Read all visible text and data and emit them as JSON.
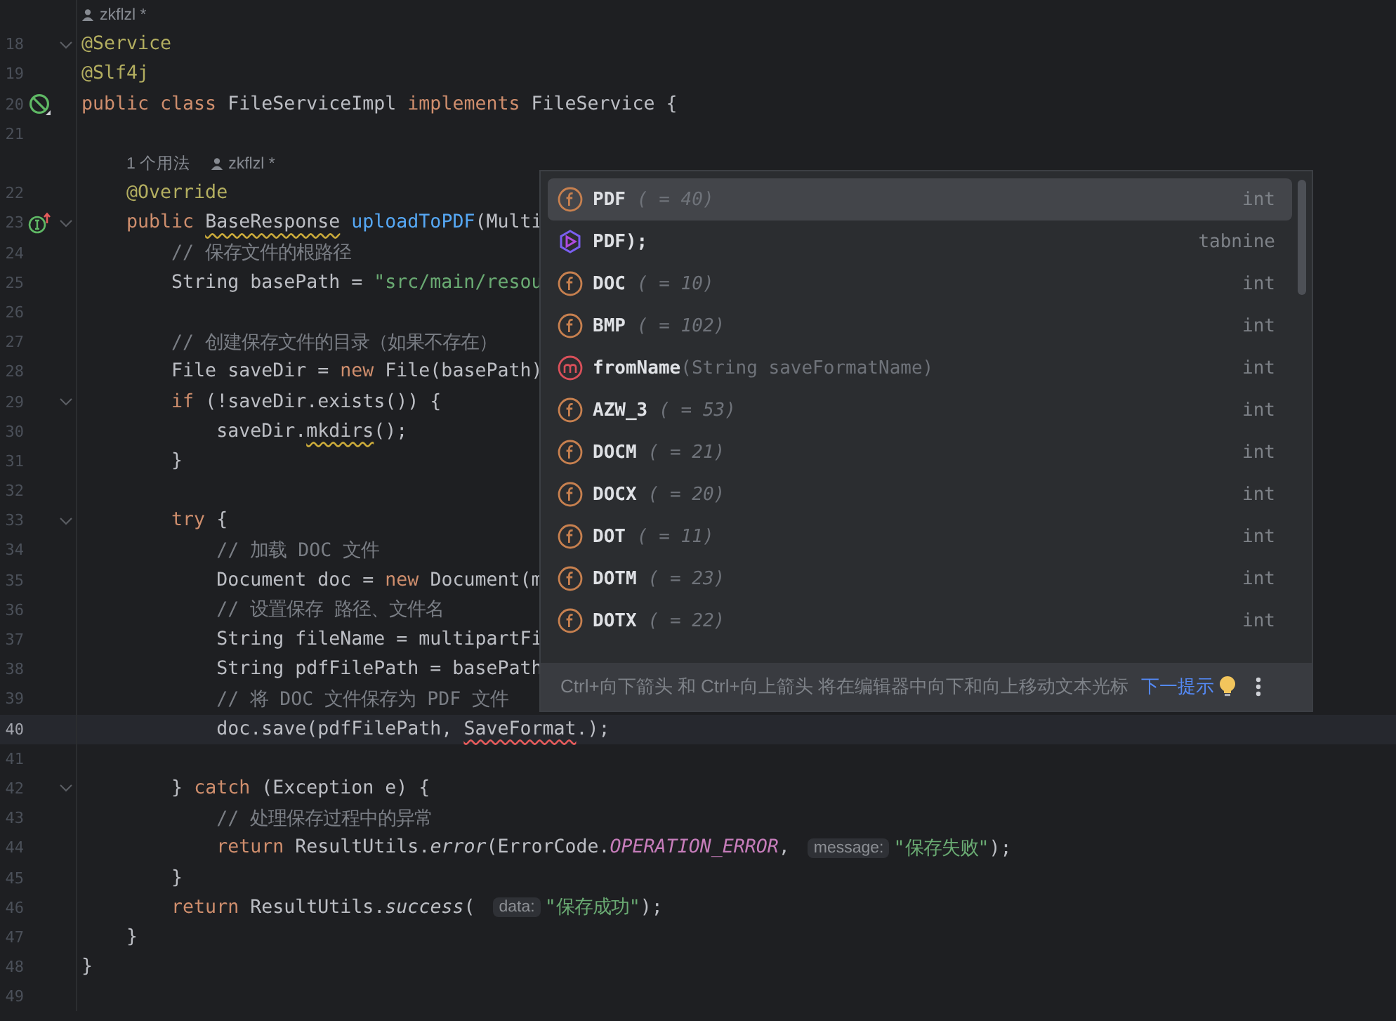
{
  "editor": {
    "lines": [
      {
        "number": "18",
        "fold": true,
        "above": [
          {
            "kind": "author",
            "text": "zkflzl *"
          }
        ],
        "tokens": [
          {
            "kind": "ann",
            "text": "@Service"
          }
        ]
      },
      {
        "number": "19",
        "tokens": [
          {
            "kind": "ann",
            "text": "@Slf4j"
          }
        ]
      },
      {
        "number": "20",
        "gutter_mark": {
          "kind": "bean"
        },
        "tokens": [
          {
            "kind": "kw",
            "text": "public class "
          },
          {
            "kind": "txt",
            "text": "FileServiceImpl "
          },
          {
            "kind": "kw",
            "text": "implements "
          },
          {
            "kind": "txt",
            "text": "FileService {"
          }
        ]
      },
      {
        "number": "21"
      },
      {
        "number": "22",
        "above": [
          {
            "kind": "usage",
            "text": "1 个用法"
          },
          {
            "kind": "author",
            "text": "zkflzl *"
          }
        ],
        "tokens": [
          {
            "kind": "ann",
            "text": "    @Override"
          }
        ]
      },
      {
        "number": "23",
        "fold": true,
        "gutter_mark": {
          "kind": "implements"
        },
        "tokens": [
          {
            "kind": "kw",
            "text": "    public "
          },
          {
            "kind": "txt",
            "text": "BaseResponse",
            "warning": true
          },
          {
            "kind": "fn",
            "text": " uploadToPDF"
          },
          {
            "kind": "txt",
            "text": "(Multi"
          }
        ]
      },
      {
        "number": "24",
        "tokens": [
          {
            "kind": "cmt",
            "text": "        // 保存文件的根路径"
          }
        ]
      },
      {
        "number": "25",
        "tokens": [
          {
            "kind": "txt",
            "text": "        String basePath = "
          },
          {
            "kind": "str",
            "text": "\"src/main/resou"
          }
        ]
      },
      {
        "number": "26"
      },
      {
        "number": "27",
        "tokens": [
          {
            "kind": "cmt",
            "text": "        // 创建保存文件的目录（如果不存在）"
          }
        ]
      },
      {
        "number": "28",
        "tokens": [
          {
            "kind": "txt",
            "text": "        File saveDir = "
          },
          {
            "kind": "kw",
            "text": "new "
          },
          {
            "kind": "txt",
            "text": "File(basePath)"
          }
        ]
      },
      {
        "number": "29",
        "fold": true,
        "tokens": [
          {
            "kind": "kw",
            "text": "        if "
          },
          {
            "kind": "txt",
            "text": "(!saveDir.exists()) {"
          }
        ]
      },
      {
        "number": "30",
        "tokens": [
          {
            "kind": "txt",
            "text": "            saveDir."
          },
          {
            "kind": "txt",
            "text": "mkdirs",
            "warning": true
          },
          {
            "kind": "txt",
            "text": "();"
          }
        ]
      },
      {
        "number": "31",
        "tokens": [
          {
            "kind": "txt",
            "text": "        }"
          }
        ]
      },
      {
        "number": "32"
      },
      {
        "number": "33",
        "fold": true,
        "tokens": [
          {
            "kind": "kw",
            "text": "        try "
          },
          {
            "kind": "txt",
            "text": "{"
          }
        ]
      },
      {
        "number": "34",
        "tokens": [
          {
            "kind": "cmt",
            "text": "            // 加载 DOC 文件"
          }
        ]
      },
      {
        "number": "35",
        "tokens": [
          {
            "kind": "txt",
            "text": "            Document doc = "
          },
          {
            "kind": "kw",
            "text": "new "
          },
          {
            "kind": "txt",
            "text": "Document(m"
          }
        ]
      },
      {
        "number": "36",
        "tokens": [
          {
            "kind": "cmt",
            "text": "            // 设置保存 路径、文件名"
          }
        ]
      },
      {
        "number": "37",
        "tokens": [
          {
            "kind": "txt",
            "text": "            String fileName = multipartFi"
          }
        ]
      },
      {
        "number": "38",
        "tokens": [
          {
            "kind": "txt",
            "text": "            String pdfFilePath = basePath"
          }
        ]
      },
      {
        "number": "39",
        "tokens": [
          {
            "kind": "cmt",
            "text": "            // 将 DOC 文件保存为 PDF 文件"
          }
        ]
      },
      {
        "number": "40",
        "current": true,
        "tokens": [
          {
            "kind": "txt",
            "text": "            doc.save(pdfFilePath, "
          },
          {
            "kind": "txt",
            "text": "SaveFormat",
            "error": true
          },
          {
            "kind": "txt",
            "text": ".);"
          }
        ]
      },
      {
        "number": "41"
      },
      {
        "number": "42",
        "fold": true,
        "tokens": [
          {
            "kind": "txt",
            "text": "        } "
          },
          {
            "kind": "kw",
            "text": "catch "
          },
          {
            "kind": "txt",
            "text": "(Exception e) {"
          }
        ]
      },
      {
        "number": "43",
        "tokens": [
          {
            "kind": "cmt",
            "text": "            // 处理保存过程中的异常"
          }
        ]
      },
      {
        "number": "44",
        "tokens": [
          {
            "kind": "kw",
            "text": "            return "
          },
          {
            "kind": "txt",
            "text": "ResultUtils."
          },
          {
            "kind": "ital",
            "text": "error"
          },
          {
            "kind": "txt",
            "text": "(ErrorCode."
          },
          {
            "kind": "const",
            "text": "OPERATION_ERROR"
          },
          {
            "kind": "txt",
            "text": ","
          },
          {
            "kind": "param",
            "text": "message:"
          },
          {
            "kind": "str",
            "text": "\"保存失败\""
          },
          {
            "kind": "txt",
            "text": ");"
          }
        ]
      },
      {
        "number": "45",
        "tokens": [
          {
            "kind": "txt",
            "text": "        }"
          }
        ]
      },
      {
        "number": "46",
        "tokens": [
          {
            "kind": "kw",
            "text": "        return "
          },
          {
            "kind": "txt",
            "text": "ResultUtils."
          },
          {
            "kind": "ital",
            "text": "success"
          },
          {
            "kind": "txt",
            "text": "("
          },
          {
            "kind": "param",
            "text": "data:"
          },
          {
            "kind": "str",
            "text": "\"保存成功\""
          },
          {
            "kind": "txt",
            "text": ");"
          }
        ]
      },
      {
        "number": "47",
        "tokens": [
          {
            "kind": "txt",
            "text": "    }"
          }
        ]
      },
      {
        "number": "48",
        "tokens": [
          {
            "kind": "txt",
            "text": "}"
          }
        ]
      },
      {
        "number": "49"
      }
    ]
  },
  "completion": {
    "items": [
      {
        "kind": "field",
        "name": "PDF",
        "detail": "( = 40)",
        "type": "int",
        "selected": true
      },
      {
        "kind": "tabnine",
        "name": "PDF);",
        "type": "tabnine",
        "selected": false
      },
      {
        "kind": "field",
        "name": "DOC",
        "detail": "( = 10)",
        "type": "int",
        "selected": false
      },
      {
        "kind": "field",
        "name": "BMP",
        "detail": "( = 102)",
        "type": "int",
        "selected": false
      },
      {
        "kind": "method",
        "name": "fromName",
        "detail": "(String saveFormatName)",
        "type": "int",
        "selected": false
      },
      {
        "kind": "field",
        "name": "AZW_3",
        "detail": "( = 53)",
        "type": "int",
        "selected": false
      },
      {
        "kind": "field",
        "name": "DOCM",
        "detail": "( = 21)",
        "type": "int",
        "selected": false
      },
      {
        "kind": "field",
        "name": "DOCX",
        "detail": "( = 20)",
        "type": "int",
        "selected": false
      },
      {
        "kind": "field",
        "name": "DOT",
        "detail": "( = 11)",
        "type": "int",
        "selected": false
      },
      {
        "kind": "field",
        "name": "DOTM",
        "detail": "( = 23)",
        "type": "int",
        "selected": false
      },
      {
        "kind": "field",
        "name": "DOTX",
        "detail": "( = 22)",
        "type": "int",
        "selected": false
      }
    ],
    "footer": {
      "hint": "Ctrl+向下箭头 和 Ctrl+向上箭头 将在编辑器中向下和向上移动文本光标",
      "link": "下一提示"
    }
  }
}
